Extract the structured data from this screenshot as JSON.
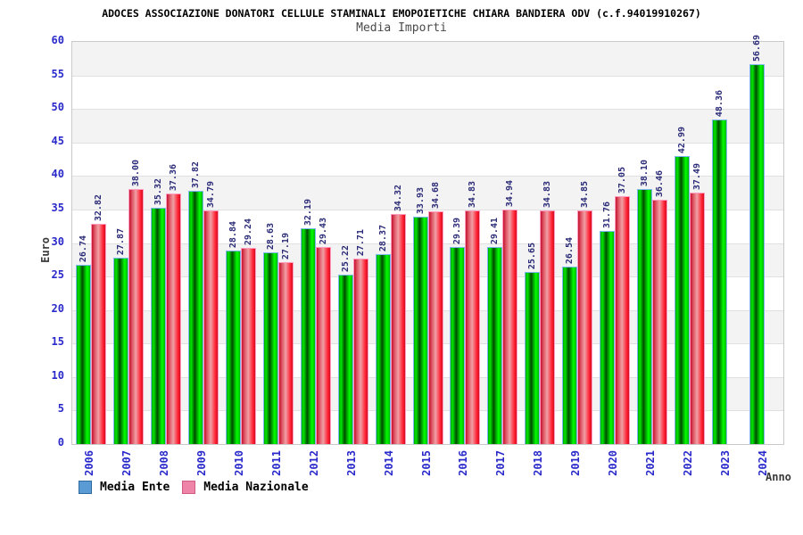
{
  "title": "ADOCES ASSOCIAZIONE DONATORI CELLULE STAMINALI EMOPOIETICHE CHIARA BANDIERA ODV (c.f.94019910267)",
  "subtitle": "Media Importi",
  "axes": {
    "y_label": "Euro",
    "x_label": "Anno",
    "y_ticks": [
      0,
      5,
      10,
      15,
      20,
      25,
      30,
      35,
      40,
      45,
      50,
      55,
      60
    ]
  },
  "legend": [
    {
      "label": "Media Ente",
      "color": "#5b9bd5",
      "border": "#2f6a9e"
    },
    {
      "label": "Media Nazionale",
      "color": "#ee84a8",
      "border": "#d05c86"
    }
  ],
  "colors": {
    "axis_label_blue": "#2a2acb",
    "value_label_navy": "#2b2b78",
    "band_gray": "#f3f3f3",
    "band_white": "#ffffff",
    "gridline": "#e0e0e0",
    "plot_border": "#c9c9c9",
    "title_black": "#000000",
    "subtitle_gray": "#4a4a4a",
    "axis_title_dark": "#3a3a3a",
    "bar_green": "#00cc00",
    "bar_green_border": "#7db9f0",
    "bar_red": "#e83a4a",
    "bar_red_border": "#ff9cc0"
  },
  "chart_data": {
    "type": "bar",
    "title": "Media Importi",
    "xlabel": "Anno",
    "ylabel": "Euro",
    "ylim": [
      0,
      60
    ],
    "y_step": 5,
    "grid": "horizontal-bands",
    "legend_position": "bottom-left",
    "categories": [
      "2006",
      "2007",
      "2008",
      "2009",
      "2010",
      "2011",
      "2012",
      "2013",
      "2014",
      "2015",
      "2016",
      "2017",
      "2018",
      "2019",
      "2020",
      "2021",
      "2022",
      "2023",
      "2024"
    ],
    "series": [
      {
        "name": "Media Ente",
        "key": "ente",
        "color": "#00cc00",
        "values": [
          26.74,
          27.87,
          35.32,
          37.82,
          28.84,
          28.63,
          32.19,
          25.22,
          28.37,
          33.93,
          29.39,
          29.41,
          25.65,
          26.54,
          31.76,
          38.1,
          42.99,
          48.36,
          56.69
        ],
        "labels": [
          "26.74",
          "27.87",
          "35.32",
          "37.82",
          "28.84",
          "28.63",
          "32.19",
          "25.22",
          "28.37",
          "33.93",
          "29.39",
          "29.41",
          "25.65",
          "26.54",
          "31.76",
          "38.10",
          "42.99",
          "48.36",
          "56.69"
        ]
      },
      {
        "name": "Media Nazionale",
        "key": "nazionale",
        "color": "#e83a4a",
        "values": [
          32.82,
          38.0,
          37.36,
          34.79,
          29.24,
          27.19,
          29.43,
          27.71,
          34.32,
          34.68,
          34.83,
          34.94,
          34.83,
          34.85,
          37.05,
          36.46,
          37.49,
          null,
          null
        ],
        "labels": [
          "32.82",
          "38.00",
          "37.36",
          "34.79",
          "29.24",
          "27.19",
          "29.43",
          "27.71",
          "34.32",
          "34.68",
          "34.83",
          "34.94",
          "34.83",
          "34.85",
          "37.05",
          "36.46",
          "37.49",
          null,
          null
        ]
      }
    ]
  }
}
